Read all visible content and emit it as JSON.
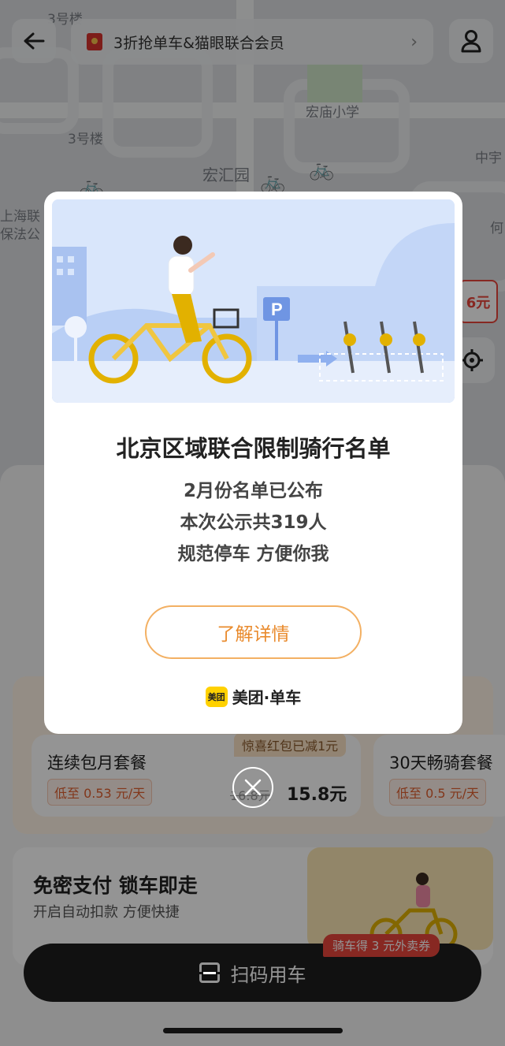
{
  "top_bar": {
    "banner_text": "3折抢单车&猫眼联合会员",
    "back_icon": "back-arrow-icon",
    "user_icon": "user-icon"
  },
  "map": {
    "labels": [
      "3号楼",
      "宏庙小学",
      "3号楼",
      "宏汇园",
      "中宇",
      "上海联",
      "保法公",
      "何"
    ],
    "floating_price": "6元"
  },
  "sheet": {
    "plans": [
      {
        "title": "连续包月套餐",
        "tag": "低至 0.53 元/天",
        "badge": "惊喜红包已减1元",
        "old_price": "16.8元",
        "price": "15.8元"
      },
      {
        "title": "30天畅骑套餐",
        "tag": "低至 0.5 元/天"
      }
    ],
    "promo_title": "免密支付 锁车即走",
    "promo_sub": "开启自动扣款 方便快捷",
    "coupon": "骑车得 3 元外卖券",
    "scan_label": "扫码用车"
  },
  "modal": {
    "title": "北京区域联合限制骑行名单",
    "lines": [
      "2月份名单已公布",
      "本次公示共319人",
      "规范停车 方便你我"
    ],
    "button": "了解详情",
    "brand_logo": "美团",
    "brand_name": "美团·单车"
  },
  "colors": {
    "accent_orange": "#e98b2e",
    "brand_yellow": "#ffd100",
    "button_dark": "#1e1e1e",
    "coupon_red": "#e8453c"
  }
}
